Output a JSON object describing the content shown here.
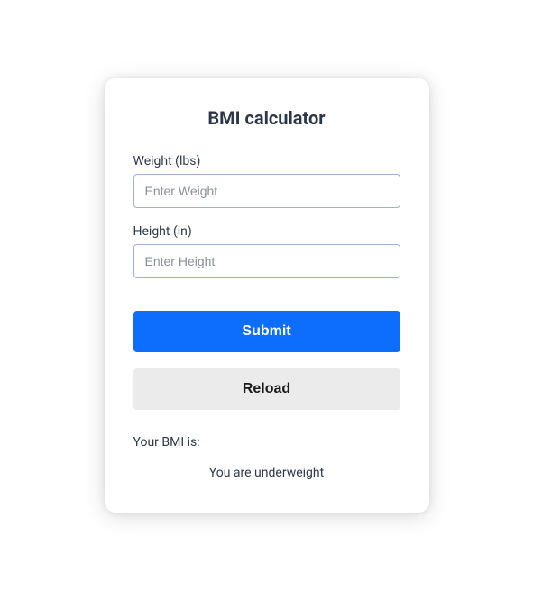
{
  "title": "BMI calculator",
  "form": {
    "weight": {
      "label": "Weight (lbs)",
      "placeholder": "Enter Weight",
      "value": ""
    },
    "height": {
      "label": "Height (in)",
      "placeholder": "Enter Height",
      "value": ""
    }
  },
  "buttons": {
    "submit": "Submit",
    "reload": "Reload"
  },
  "result": {
    "label": "Your BMI is:",
    "message": "You are underweight"
  }
}
